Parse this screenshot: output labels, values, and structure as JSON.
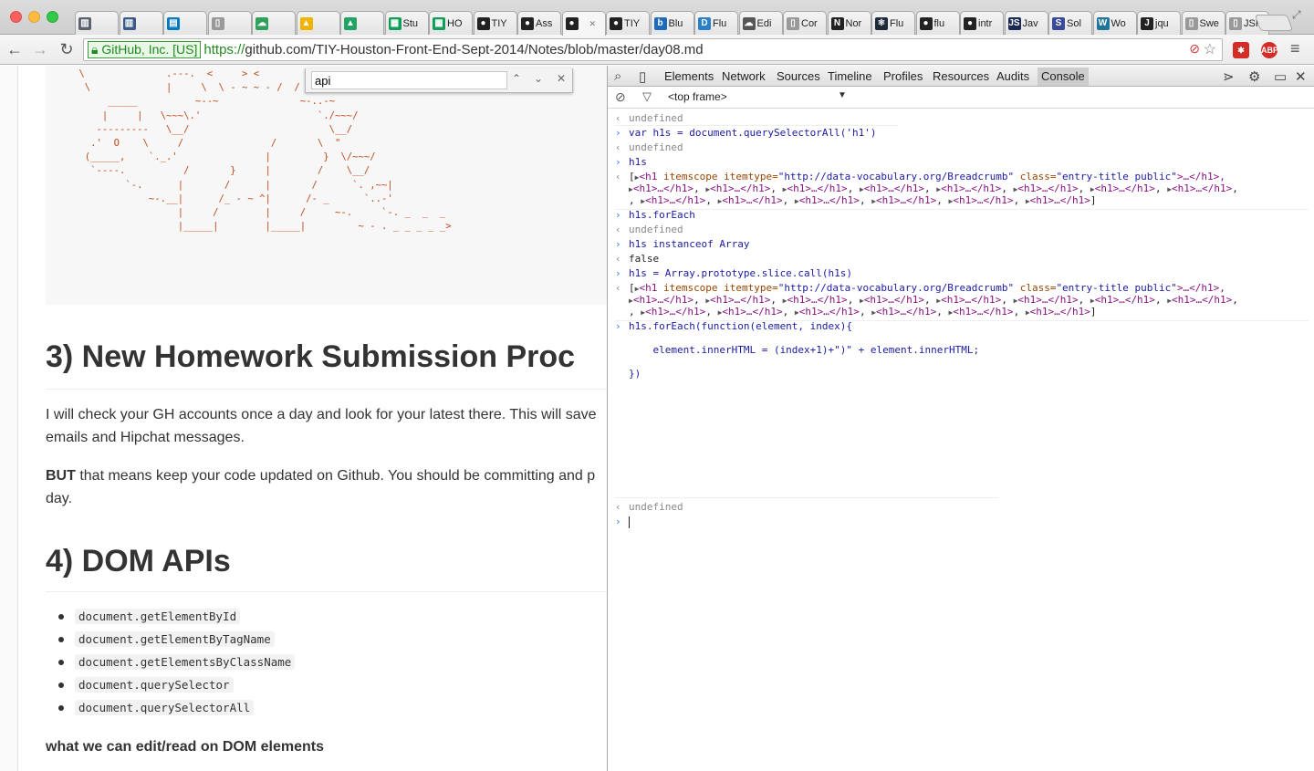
{
  "browser": {
    "tabs": [
      {
        "icon": "chart-icon",
        "label": "",
        "color": "#5a6270"
      },
      {
        "icon": "chart-icon",
        "label": "",
        "color": "#3a5a88"
      },
      {
        "icon": "trello-icon",
        "label": "",
        "color": "#0079bf"
      },
      {
        "icon": "doc-icon",
        "label": "",
        "color": "#999999"
      },
      {
        "icon": "cloud-icon",
        "label": "",
        "color": "#2fa15b"
      },
      {
        "icon": "drive-icon",
        "label": "",
        "color": "#f0b400"
      },
      {
        "icon": "drive-icon",
        "label": "",
        "color": "#1fa463"
      },
      {
        "icon": "sheet-icon",
        "label": "Stu",
        "color": "#0f9d58"
      },
      {
        "icon": "sheet-icon",
        "label": "HO",
        "color": "#0f9d58"
      },
      {
        "icon": "github-icon",
        "label": "TIY",
        "color": "#222222"
      },
      {
        "icon": "github-icon",
        "label": "Ass",
        "color": "#222222"
      },
      {
        "icon": "github-icon",
        "label": "",
        "color": "#222222"
      },
      {
        "icon": "github-icon",
        "label": "TIY",
        "color": "#222222"
      },
      {
        "icon": "blue-icon",
        "label": "Blu",
        "color": "#1c6bbd"
      },
      {
        "icon": "dr-icon",
        "label": "Flu",
        "color": "#2a7fc9"
      },
      {
        "icon": "cloud-edit-icon",
        "label": "Edi",
        "color": "#555555"
      },
      {
        "icon": "doc-icon",
        "label": "Cor",
        "color": "#999999"
      },
      {
        "icon": "n-icon",
        "label": "Nor",
        "color": "#222222"
      },
      {
        "icon": "react-icon",
        "label": "Flu",
        "color": "#1e2a3a"
      },
      {
        "icon": "github-icon",
        "label": "flu",
        "color": "#222222"
      },
      {
        "icon": "github-icon",
        "label": "intr",
        "color": "#222222"
      },
      {
        "icon": "js-icon",
        "label": "Jav",
        "color": "#1b2a55"
      },
      {
        "icon": "so-icon",
        "label": "Sol",
        "color": "#3a4a9a"
      },
      {
        "icon": "wp-icon",
        "label": "Wo",
        "color": "#21759b"
      },
      {
        "icon": "j-icon",
        "label": "jqu",
        "color": "#222222"
      },
      {
        "icon": "doc-icon",
        "label": "Swe",
        "color": "#999999"
      },
      {
        "icon": "doc-icon",
        "label": "JSH",
        "color": "#999999"
      }
    ],
    "active_tab_index": 11,
    "ev_badge": "GitHub, Inc. [US]",
    "url_scheme": "https://",
    "url_rest": "github.com/TIY-Houston-Front-End-Sept-2014/Notes/blob/master/day08.md"
  },
  "find": {
    "query": "api"
  },
  "page": {
    "ascii_art": " \\              .---.  <     > <\n  \\             |     \\  \\ - ~ ~ - /  /    |\n      _____          ~--~              ~-..-~\n     |     |   \\~~~\\.'                    `./~~~/\n    ---------   \\__/                        \\__/\n   .'  O    \\     /               /       \\  \"\n  (_____,    `._.'               |         }  \\/~~~/\n   `----.          /       }     |        /    \\__/\n         `-.      |       /      |       /      `. ,~~|\n             ~-.__|      /_ - ~ ^|      /- _      `..-'\n                  |     /        |     /     ~-.     `-. _  _  _\n                  |_____|        |_____|         ~ - . _ _ _ _ _>",
    "h2_3": "3) New Homework Submission Proc",
    "p1": "I will check your GH accounts once a day and look for your latest there. This will save emails and Hipchat messages.",
    "p2_bold": "BUT",
    "p2_rest": " that means keep your code updated on Github. You should be committing and p day.",
    "h2_4": "4) DOM APIs",
    "apis": [
      "document.getElementById",
      "document.getElementByTagName",
      "document.getElementsByClassName",
      "document.querySelector",
      "document.querySelectorAll"
    ],
    "bold_line": "what we can edit/read on DOM elements"
  },
  "devtools": {
    "tabs": [
      "Elements",
      "Network",
      "Sources",
      "Timeline",
      "Profiles",
      "Resources",
      "Audits",
      "Console"
    ],
    "active": "Console",
    "frame": "<top frame>",
    "lines": {
      "l1": "undefined",
      "l2": "var h1s = document.querySelectorAll('h1')",
      "l3": "undefined",
      "l4": "h1s",
      "l6": "h1s.forEach",
      "l7": "undefined",
      "l8": "h1s instanceof Array",
      "l9": "false",
      "l10": "h1s = Array.prototype.slice.call(h1s)",
      "l12a": "h1s.forEach(function(element, index){",
      "l12b": "    element.innerHTML = (index+1)+\")\" + element.innerHTML;",
      "l12c": "})",
      "l13": "undefined"
    },
    "nodelist_first": {
      "tag": "<h1",
      "a1": " itemscope",
      "a2": " itemtype=",
      "v2": "\"http://data-vocabulary.org/Breadcrumb\"",
      "a3": " class=",
      "v3": "\"entry-title public\"",
      "end": ">…</h1>,"
    },
    "h1_item": "<h1>…</h1>"
  }
}
